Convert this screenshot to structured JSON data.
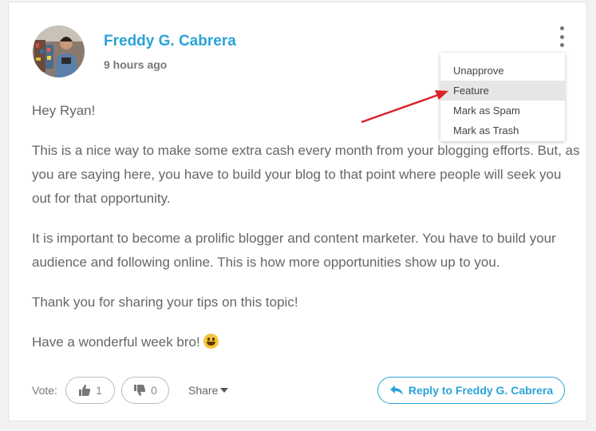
{
  "comment": {
    "author": "Freddy G. Cabrera",
    "time": "9 hours ago",
    "paragraphs": [
      "Hey Ryan!",
      "This is a nice way to make some extra cash every month from your blogging efforts. But, as you are saying here, you have to build your blog to that point where people will seek you out for that opportunity.",
      "It is important to become a prolific blogger and content marketer. You have to build your audience and following online. This is how more opportunities show up to you.",
      "Thank you for sharing your tips on this topic!",
      "Have a wonderful week bro!"
    ]
  },
  "menu": {
    "items": [
      "Unapprove",
      "Feature",
      "Mark as Spam",
      "Mark as Trash"
    ],
    "highlighted": "Feature"
  },
  "footer": {
    "vote_label": "Vote:",
    "upvotes": "1",
    "downvotes": "0",
    "share_label": "Share",
    "reply_label": "Reply to Freddy G. Cabrera"
  },
  "icons": {
    "more": "more-vertical-icon",
    "upvote": "thumbs-up-icon",
    "downvote": "thumbs-down-icon",
    "reply": "reply-arrow-icon",
    "emoji": "grinning-face-emoji"
  },
  "colors": {
    "accent": "#2aa3d8",
    "annotation_arrow": "#d9232a",
    "highlight_bg": "#e6e6e6"
  }
}
